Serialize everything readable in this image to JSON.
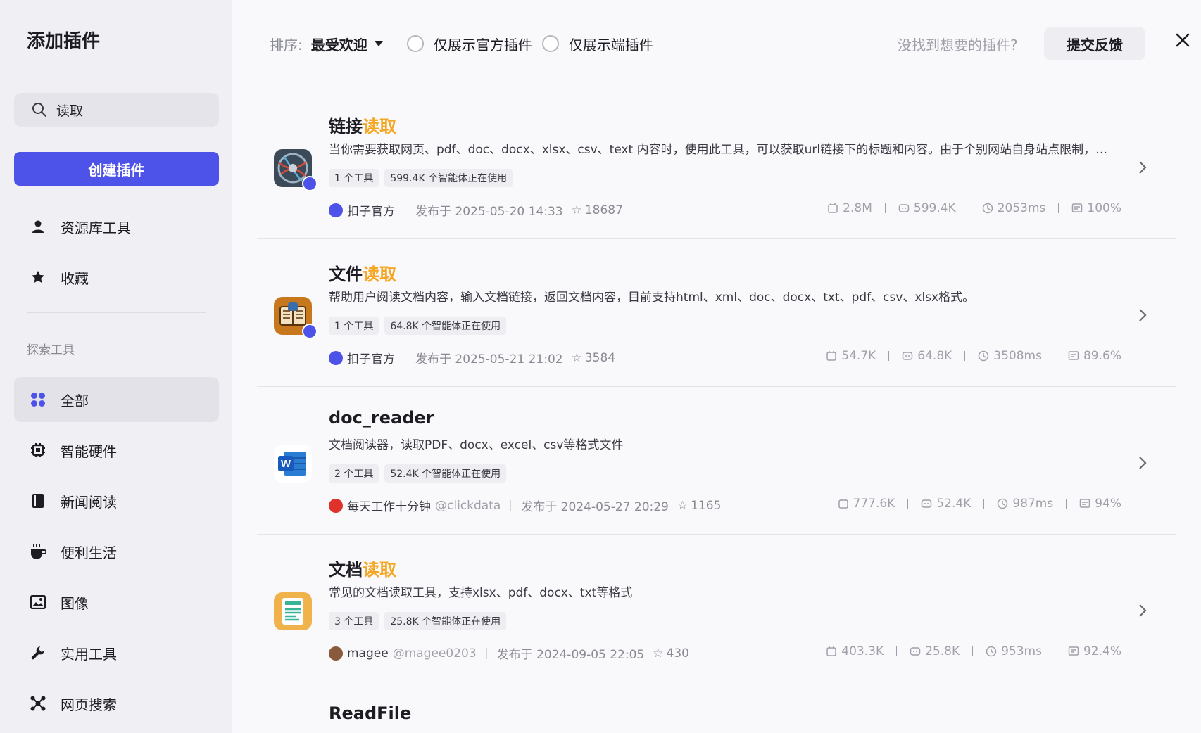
{
  "sidebar": {
    "title": "添加插件",
    "search_value": "读取",
    "create_label": "创建插件",
    "nav_top": [
      {
        "label": "资源库工具",
        "icon": "user-icon"
      },
      {
        "label": "收藏",
        "icon": "star-icon"
      }
    ],
    "section_label": "探索工具",
    "nav_explore": [
      {
        "label": "全部",
        "icon": "grid-icon",
        "active": true
      },
      {
        "label": "智能硬件",
        "icon": "chip-icon"
      },
      {
        "label": "新闻阅读",
        "icon": "book-icon"
      },
      {
        "label": "便利生活",
        "icon": "cup-icon"
      },
      {
        "label": "图像",
        "icon": "image-icon"
      },
      {
        "label": "实用工具",
        "icon": "wrench-icon"
      },
      {
        "label": "网页搜索",
        "icon": "network-icon"
      }
    ]
  },
  "toolbar": {
    "sort_label": "排序:",
    "sort_value": "最受欢迎",
    "filter_official": "仅展示官方插件",
    "filter_client": "仅展示端插件",
    "not_found": "没找到想要的插件?",
    "feedback": "提交反馈"
  },
  "plugins": [
    {
      "name_prefix": "链接",
      "name_highlight": "读取",
      "description": "当你需要获取网页、pdf、doc、docx、xlsx、csv、text 内容时，使用此工具，可以获取url链接下的标题和内容。由于个别网站自身站点限制，无法获取网页内容。",
      "tools": "1 个工具",
      "usage": "599.4K 个智能体正在使用",
      "author": "扣子官方",
      "handle": "",
      "published": "发布于 2025-05-20 14:33",
      "stars": "18687",
      "calls": "2.8M",
      "bots": "599.4K",
      "latency": "2053ms",
      "success": "100%"
    },
    {
      "name_prefix": "文件",
      "name_highlight": "读取",
      "description": "帮助用户阅读文档内容，输入文档链接，返回文档内容，目前支持html、xml、doc、docx、txt、pdf、csv、xlsx格式。",
      "tools": "1 个工具",
      "usage": "64.8K 个智能体正在使用",
      "author": "扣子官方",
      "handle": "",
      "published": "发布于 2025-05-21 21:02",
      "stars": "3584",
      "calls": "54.7K",
      "bots": "64.8K",
      "latency": "3508ms",
      "success": "89.6%"
    },
    {
      "name_prefix": "doc_reader",
      "name_highlight": "",
      "description": "文档阅读器，读取PDF、docx、excel、csv等格式文件",
      "tools": "2 个工具",
      "usage": "52.4K 个智能体正在使用",
      "author": "每天工作十分钟",
      "handle": "@clickdata",
      "published": "发布于 2024-05-27 20:29",
      "stars": "1165",
      "calls": "777.6K",
      "bots": "52.4K",
      "latency": "987ms",
      "success": "94%"
    },
    {
      "name_prefix": "文档",
      "name_highlight": "读取",
      "description": "常见的文档读取工具，支持xlsx、pdf、docx、txt等格式",
      "tools": "3 个工具",
      "usage": "25.8K 个智能体正在使用",
      "author": "magee",
      "handle": "@magee0203",
      "published": "发布于 2024-09-05 22:05",
      "stars": "430",
      "calls": "403.3K",
      "bots": "25.8K",
      "latency": "953ms",
      "success": "92.4%"
    },
    {
      "name_prefix": "ReadFile",
      "name_highlight": ""
    }
  ]
}
